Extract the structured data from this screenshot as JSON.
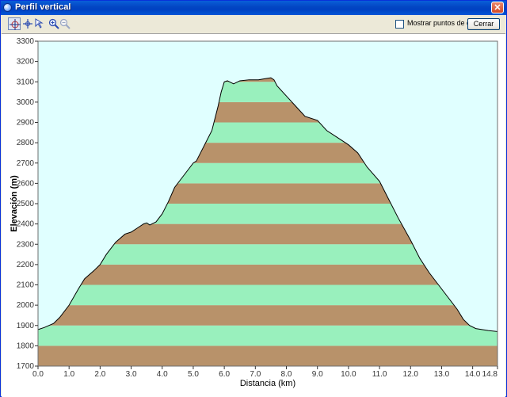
{
  "window": {
    "title": "Perfil vertical",
    "close_glyph": "✕"
  },
  "toolbar": {
    "tools": [
      {
        "name": "pan-crosshair-icon",
        "active": true
      },
      {
        "name": "crosshair-icon",
        "active": false
      },
      {
        "name": "select-cursor-icon",
        "active": false
      },
      {
        "name": "zoom-in-icon",
        "active": false
      },
      {
        "name": "zoom-out-icon",
        "active": false
      }
    ],
    "show_waypoints_label": "Mostrar puntos de camino",
    "show_waypoints_checked": false,
    "close_button": "Cerrar"
  },
  "colors": {
    "plot_background": "#e0ffff",
    "band_green": "#99f0bd",
    "band_brown": "#b8926a",
    "outline": "#000000"
  },
  "chart_data": {
    "type": "area",
    "xlabel": "Distancia   (km)",
    "ylabel": "Elevación (m)",
    "xlim": [
      0,
      14.8
    ],
    "ylim": [
      1700,
      3300
    ],
    "x_ticks": [
      "0.0",
      "1.0",
      "2.0",
      "3.0",
      "4.0",
      "5.0",
      "6.0",
      "7.0",
      "8.0",
      "9.0",
      "10.0",
      "11.0",
      "12.0",
      "13.0",
      "14.0",
      "14.8"
    ],
    "y_ticks": [
      "1700",
      "1800",
      "1900",
      "2000",
      "2100",
      "2200",
      "2300",
      "2400",
      "2500",
      "2600",
      "2700",
      "2800",
      "2900",
      "3000",
      "3100",
      "3200",
      "3300"
    ],
    "band_height": 100,
    "series": [
      {
        "x": [
          0.0,
          0.2,
          0.5,
          0.7,
          1.0,
          1.3,
          1.5,
          1.8,
          2.0,
          2.2,
          2.5,
          2.8,
          3.0,
          3.2,
          3.4,
          3.5,
          3.6,
          3.8,
          4.0,
          4.2,
          4.4,
          4.6,
          4.8,
          5.0,
          5.1,
          5.3,
          5.4,
          5.6,
          5.7,
          5.8,
          5.9,
          6.0,
          6.1,
          6.3,
          6.5,
          6.8,
          7.1,
          7.3,
          7.5,
          7.6,
          7.7,
          8.0,
          8.3,
          8.6,
          9.0,
          9.3,
          9.6,
          10.0,
          10.3,
          10.6,
          11.0,
          11.3,
          11.6,
          12.0,
          12.3,
          12.6,
          12.9,
          13.2,
          13.5,
          13.7,
          13.9,
          14.1,
          14.3,
          14.5,
          14.8
        ],
        "y": [
          1880,
          1890,
          1910,
          1940,
          2000,
          2080,
          2130,
          2170,
          2200,
          2250,
          2310,
          2350,
          2360,
          2380,
          2400,
          2405,
          2395,
          2410,
          2450,
          2510,
          2580,
          2620,
          2660,
          2700,
          2710,
          2770,
          2800,
          2860,
          2920,
          2980,
          3050,
          3100,
          3105,
          3090,
          3105,
          3110,
          3110,
          3115,
          3120,
          3110,
          3080,
          3030,
          2980,
          2930,
          2910,
          2860,
          2830,
          2790,
          2750,
          2680,
          2610,
          2520,
          2430,
          2320,
          2230,
          2160,
          2100,
          2040,
          1980,
          1930,
          1900,
          1885,
          1880,
          1875,
          1870
        ]
      }
    ]
  }
}
